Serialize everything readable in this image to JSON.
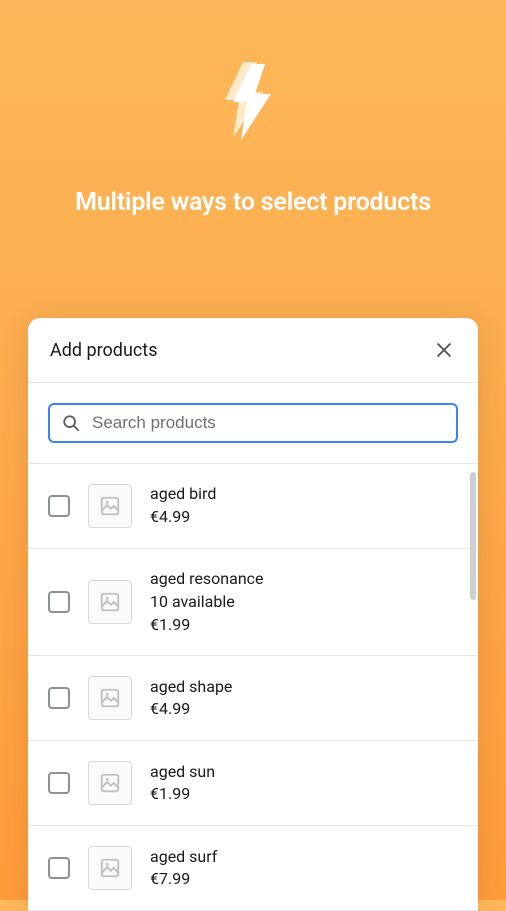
{
  "hero": {
    "title": "Multiple ways to select products"
  },
  "modal": {
    "title": "Add products",
    "search_placeholder": "Search products"
  },
  "products": [
    {
      "name": "aged bird",
      "availability": "",
      "price": "€4.99"
    },
    {
      "name": "aged resonance",
      "availability": "10 available",
      "price": "€1.99"
    },
    {
      "name": "aged shape",
      "availability": "",
      "price": "€4.99"
    },
    {
      "name": "aged sun",
      "availability": "",
      "price": "€1.99"
    },
    {
      "name": "aged surf",
      "availability": "",
      "price": "€7.99"
    }
  ]
}
